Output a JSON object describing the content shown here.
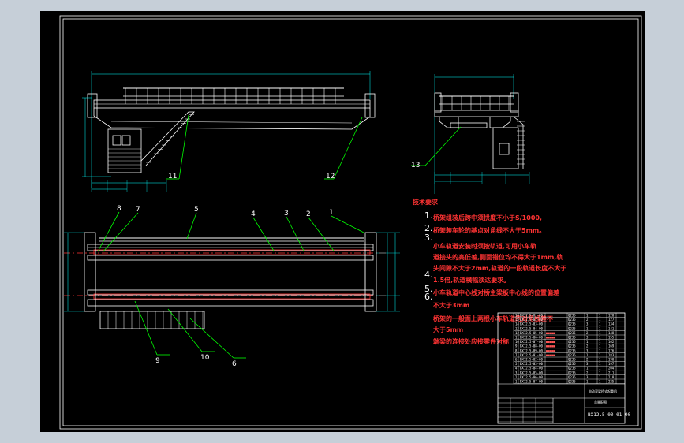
{
  "colors": {
    "background": "#c6cfd8",
    "sheet": "#000000",
    "line": "#ffffff",
    "leader": "#00ff00",
    "dimension": "#00ffff",
    "note": "#ff3333",
    "axis": "#ff3333"
  },
  "notes": {
    "heading": "技术要求",
    "numbers": [
      "1.",
      "2.",
      "3.",
      "4.",
      "5.",
      "6."
    ],
    "lines": [
      "桥架组装后跨中须拱度不小于S/1000,",
      "桥架装车轮的基点对角线不大于5mm。",
      "小车轨道安装时须按轨道,可用小车轨",
      "道接头的高低差,侧面错位均不得大于1mm,轨",
      "头间隙不大于2mm,轨道的一段轨道长度不大于",
      "1.5倍,轨道横幅须达要求。",
      "小车轨道中心线对桥主梁板中心线的位置偏差",
      "不大于3mm",
      "桥架的一般面上两根小车轨道的对角线差不",
      "大于5mm",
      "端梁的连接处应接零件对称"
    ]
  },
  "callouts": {
    "top_view": [
      "8",
      "7",
      "5",
      "4",
      "3",
      "2",
      "1"
    ],
    "bottom_view": [
      "9",
      "10",
      "6"
    ],
    "front_view": [
      "11",
      "12"
    ],
    "side_view": [
      "13"
    ]
  },
  "title_block": {
    "drawing_number": "BX12.5-00-01-00",
    "name_line1": "电动双梁桥式起重机",
    "name_line2": "总装配图"
  }
}
